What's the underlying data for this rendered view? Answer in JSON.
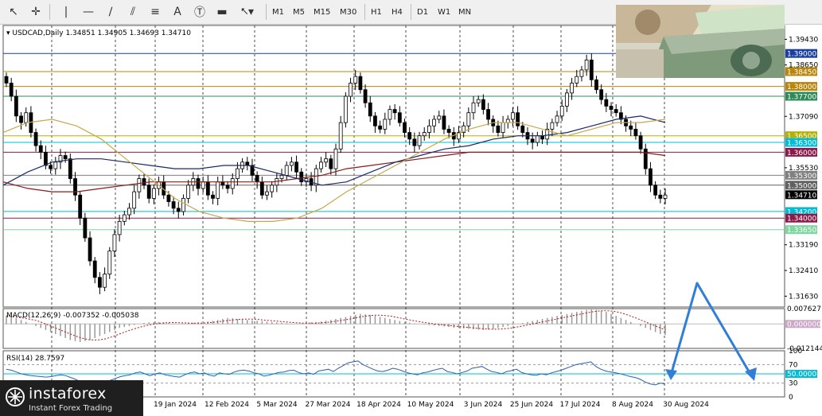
{
  "toolbar": {
    "timeframes": [
      "M1",
      "M5",
      "M15",
      "M30",
      "H1",
      "H4",
      "D1",
      "W1",
      "MN"
    ]
  },
  "chart_data": {
    "type": "candlestick",
    "symbol_header": "USDCAD,Daily",
    "ohlc": "1.34851 1.34905 1.34693 1.34710",
    "y_ticks": [
      "1.39430",
      "1.38650",
      "1.37090",
      "1.35530",
      "1.33190",
      "1.32410",
      "1.31630"
    ],
    "x_ticks": [
      "19 Jan 2024",
      "12 Feb 2024",
      "5 Mar 2024",
      "27 Mar 2024",
      "18 Apr 2024",
      "10 May 2024",
      "3 Jun 2024",
      "25 Jun 2024",
      "17 Jul 2024",
      "8 Aug 2024",
      "30 Aug 2024"
    ],
    "current_price": "1.34710",
    "levels": [
      {
        "price": 1.39,
        "label": "1.39000",
        "color": "#1a3fa0"
      },
      {
        "price": 1.3845,
        "label": "1.38450",
        "color": "#b8860b"
      },
      {
        "price": 1.38,
        "label": "1.38000",
        "color": "#b8860b"
      },
      {
        "price": 1.377,
        "label": "1.37700",
        "color": "#2e8b57"
      },
      {
        "price": 1.365,
        "label": "1.36500",
        "color": "#b5b000"
      },
      {
        "price": 1.363,
        "label": "1.36300",
        "color": "#00bcd4"
      },
      {
        "price": 1.36,
        "label": "1.36000",
        "color": "#8b1a4a"
      },
      {
        "price": 1.353,
        "label": "1.35300",
        "color": "#808080"
      },
      {
        "price": 1.35,
        "label": "1.35000",
        "color": "#606060"
      },
      {
        "price": 1.342,
        "label": "1.34200",
        "color": "#00bcd4"
      },
      {
        "price": 1.34,
        "label": "1.34000",
        "color": "#8b1a4a"
      },
      {
        "price": 1.3365,
        "label": "1.33650",
        "color": "#7fd6a0"
      }
    ],
    "closes": [
      1.381,
      1.377,
      1.371,
      1.369,
      1.372,
      1.366,
      1.362,
      1.36,
      1.356,
      1.355,
      1.357,
      1.359,
      1.358,
      1.352,
      1.347,
      1.34,
      1.334,
      1.327,
      1.322,
      1.319,
      1.323,
      1.33,
      1.335,
      1.339,
      1.341,
      1.343,
      1.348,
      1.352,
      1.35,
      1.346,
      1.349,
      1.351,
      1.347,
      1.345,
      1.343,
      1.342,
      1.346,
      1.35,
      1.352,
      1.349,
      1.351,
      1.347,
      1.346,
      1.351,
      1.35,
      1.349,
      1.352,
      1.355,
      1.357,
      1.356,
      1.353,
      1.351,
      1.347,
      1.348,
      1.35,
      1.352,
      1.353,
      1.356,
      1.357,
      1.354,
      1.351,
      1.352,
      1.35,
      1.355,
      1.357,
      1.358,
      1.355,
      1.361,
      1.369,
      1.377,
      1.381,
      1.383,
      1.379,
      1.375,
      1.371,
      1.368,
      1.367,
      1.37,
      1.373,
      1.372,
      1.369,
      1.366,
      1.364,
      1.362,
      1.365,
      1.366,
      1.368,
      1.37,
      1.371,
      1.367,
      1.366,
      1.364,
      1.366,
      1.368,
      1.372,
      1.375,
      1.376,
      1.373,
      1.37,
      1.368,
      1.366,
      1.369,
      1.37,
      1.372,
      1.368,
      1.366,
      1.364,
      1.363,
      1.365,
      1.364,
      1.367,
      1.369,
      1.371,
      1.374,
      1.378,
      1.381,
      1.383,
      1.385,
      1.388,
      1.382,
      1.379,
      1.376,
      1.374,
      1.373,
      1.372,
      1.37,
      1.368,
      1.367,
      1.365,
      1.361,
      1.355,
      1.35,
      1.347,
      1.346,
      1.347
    ],
    "ma_fast": {
      "color": "#c8a84a",
      "values": [
        1.366,
        1.369,
        1.37,
        1.368,
        1.364,
        1.358,
        1.352,
        1.346,
        1.342,
        1.34,
        1.339,
        1.339,
        1.34,
        1.343,
        1.348,
        1.352,
        1.356,
        1.36,
        1.364,
        1.367,
        1.369,
        1.369,
        1.367,
        1.365,
        1.367,
        1.369,
        1.369,
        1.37
      ]
    },
    "ma_slow": {
      "color": "#1a2a6a",
      "values": [
        1.35,
        1.354,
        1.357,
        1.358,
        1.358,
        1.357,
        1.356,
        1.355,
        1.355,
        1.356,
        1.356,
        1.354,
        1.352,
        1.35,
        1.351,
        1.354,
        1.357,
        1.359,
        1.361,
        1.362,
        1.364,
        1.365,
        1.365,
        1.366,
        1.368,
        1.37,
        1.371,
        1.369
      ]
    },
    "ma_200": {
      "color": "#8b1a1a",
      "values": [
        1.351,
        1.349,
        1.348,
        1.348,
        1.349,
        1.35,
        1.351,
        1.351,
        1.351,
        1.351,
        1.351,
        1.351,
        1.352,
        1.353,
        1.355,
        1.356,
        1.357,
        1.358,
        1.359,
        1.36,
        1.36,
        1.36,
        1.36,
        1.36,
        1.36,
        1.36,
        1.36,
        1.359
      ]
    },
    "macd": {
      "header": "MACD(12,26,9) -0.007352 -0.005038",
      "y_ticks": [
        "0.007627",
        "0.000000",
        "-0.012144"
      ],
      "hist": [
        0.004,
        0.0035,
        0.003,
        0.002,
        0.001,
        0.0,
        -0.001,
        -0.002,
        -0.003,
        -0.004,
        -0.005,
        -0.006,
        -0.007,
        -0.008,
        -0.0085,
        -0.009,
        -0.0085,
        -0.008,
        -0.007,
        -0.006,
        -0.005,
        -0.004,
        -0.003,
        -0.002,
        -0.0015,
        -0.001,
        -0.0005,
        0.0,
        0.0005,
        0.0008,
        0.001,
        0.001,
        0.0008,
        0.0005,
        0.0003,
        0.0,
        0.0002,
        0.0004,
        0.0006,
        0.0008,
        0.001,
        0.0012,
        0.0015,
        0.002,
        0.0025,
        0.003,
        0.0028,
        0.0025,
        0.0022,
        0.002,
        0.0018,
        0.0016,
        0.0014,
        0.0012,
        0.001,
        0.0008,
        0.0006,
        0.0004,
        0.0002,
        0.0,
        0.0002,
        0.0005,
        0.0008,
        0.001,
        0.0012,
        0.0016,
        0.002,
        0.0025,
        0.003,
        0.0035,
        0.004,
        0.0045,
        0.005,
        0.0048,
        0.0045,
        0.004,
        0.0035,
        0.003,
        0.0025,
        0.002,
        0.0015,
        0.001,
        0.0006,
        0.0003,
        0.0,
        -0.0003,
        -0.0005,
        -0.0008,
        -0.001,
        -0.0012,
        -0.0015,
        -0.0018,
        -0.002,
        -0.0022,
        -0.0024,
        -0.0026,
        -0.0028,
        -0.003,
        -0.0028,
        -0.0025,
        -0.002,
        -0.0015,
        -0.001,
        -0.0005,
        0.0,
        0.0005,
        0.001,
        0.0015,
        0.002,
        0.0025,
        0.003,
        0.0035,
        0.004,
        0.0045,
        0.005,
        0.0055,
        0.006,
        0.0065,
        0.007,
        0.0072,
        0.007,
        0.0065,
        0.006,
        0.005,
        0.004,
        0.003,
        0.002,
        0.001,
        0.0,
        -0.001,
        -0.002,
        -0.003,
        -0.004,
        -0.005,
        -0.0055
      ],
      "signal_color": "#b01818"
    },
    "rsi": {
      "header": "RSI(14) 28.7597",
      "y_ticks": [
        "100",
        "70",
        "50.0000",
        "30",
        "0"
      ],
      "values": [
        60,
        58,
        54,
        50,
        48,
        46,
        45,
        44,
        43,
        44,
        46,
        48,
        46,
        42,
        38,
        33,
        30,
        28,
        26,
        24,
        30,
        36,
        40,
        44,
        46,
        48,
        52,
        54,
        50,
        46,
        50,
        52,
        48,
        46,
        44,
        43,
        48,
        52,
        54,
        50,
        52,
        47,
        45,
        52,
        50,
        49,
        54,
        57,
        58,
        56,
        52,
        50,
        45,
        47,
        50,
        53,
        54,
        57,
        58,
        53,
        50,
        52,
        49,
        56,
        58,
        60,
        55,
        62,
        68,
        74,
        76,
        78,
        70,
        65,
        60,
        56,
        55,
        58,
        62,
        60,
        56,
        52,
        50,
        48,
        52,
        54,
        57,
        60,
        62,
        55,
        53,
        50,
        53,
        56,
        62,
        64,
        66,
        60,
        55,
        53,
        50,
        55,
        57,
        60,
        53,
        50,
        48,
        47,
        50,
        48,
        52,
        55,
        58,
        62,
        66,
        70,
        72,
        74,
        76,
        66,
        60,
        56,
        54,
        52,
        50,
        47,
        44,
        42,
        38,
        32,
        28,
        26,
        30,
        28
      ]
    }
  },
  "brand": {
    "name": "instaforex",
    "tagline": "Instant Forex Trading"
  }
}
